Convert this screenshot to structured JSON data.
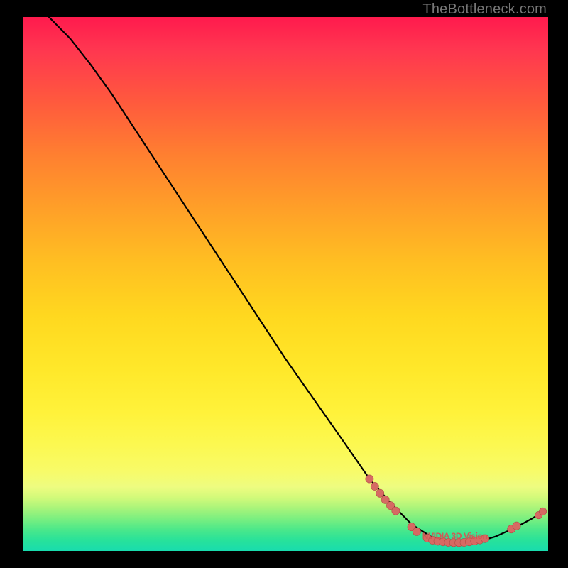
{
  "watermark": "TheBottleneck.com",
  "colors": {
    "dot_fill": "#d66a63",
    "dot_stroke": "#b14a45",
    "curve": "#000000"
  },
  "chart_data": {
    "type": "line",
    "title": "",
    "xlabel": "",
    "ylabel": "",
    "xlim": [
      0,
      100
    ],
    "ylim": [
      0,
      100
    ],
    "grid": false,
    "curve": [
      {
        "x": 5,
        "y": 100
      },
      {
        "x": 9,
        "y": 96
      },
      {
        "x": 13,
        "y": 91
      },
      {
        "x": 17,
        "y": 85.5
      },
      {
        "x": 22,
        "y": 78
      },
      {
        "x": 30,
        "y": 66
      },
      {
        "x": 40,
        "y": 51
      },
      {
        "x": 50,
        "y": 36
      },
      {
        "x": 60,
        "y": 22
      },
      {
        "x": 66,
        "y": 13.5
      },
      {
        "x": 70,
        "y": 9
      },
      {
        "x": 74,
        "y": 5
      },
      {
        "x": 78,
        "y": 2.5
      },
      {
        "x": 82,
        "y": 1.5
      },
      {
        "x": 86,
        "y": 1.5
      },
      {
        "x": 90,
        "y": 2.7
      },
      {
        "x": 94,
        "y": 4.5
      },
      {
        "x": 97,
        "y": 6.1
      },
      {
        "x": 99,
        "y": 7.3
      }
    ],
    "point_clusters": [
      {
        "cluster": "descent",
        "points": [
          {
            "x": 66,
            "y": 13.5
          },
          {
            "x": 67,
            "y": 12.1
          },
          {
            "x": 68,
            "y": 10.8
          },
          {
            "x": 69,
            "y": 9.6
          },
          {
            "x": 70,
            "y": 8.5
          },
          {
            "x": 71,
            "y": 7.5
          }
        ]
      },
      {
        "cluster": "valley",
        "points": [
          {
            "x": 74,
            "y": 4.5
          },
          {
            "x": 75,
            "y": 3.6
          },
          {
            "x": 77,
            "y": 2.4
          },
          {
            "x": 78,
            "y": 2.0
          },
          {
            "x": 79,
            "y": 1.8
          },
          {
            "x": 80,
            "y": 1.7
          },
          {
            "x": 81,
            "y": 1.6
          },
          {
            "x": 82,
            "y": 1.55
          },
          {
            "x": 83,
            "y": 1.55
          },
          {
            "x": 84,
            "y": 1.6
          },
          {
            "x": 85,
            "y": 1.7
          },
          {
            "x": 86,
            "y": 1.85
          },
          {
            "x": 87,
            "y": 2.05
          },
          {
            "x": 88,
            "y": 2.3
          }
        ]
      },
      {
        "cluster": "ascent",
        "points": [
          {
            "x": 93,
            "y": 4.1
          },
          {
            "x": 94,
            "y": 4.7
          }
        ]
      },
      {
        "cluster": "tail",
        "points": [
          {
            "x": 98.2,
            "y": 6.7
          },
          {
            "x": 99.0,
            "y": 7.4
          }
        ]
      }
    ],
    "data_label": {
      "text": "NVIDIA 3D Vision",
      "x": 82,
      "y": 2.0
    }
  }
}
